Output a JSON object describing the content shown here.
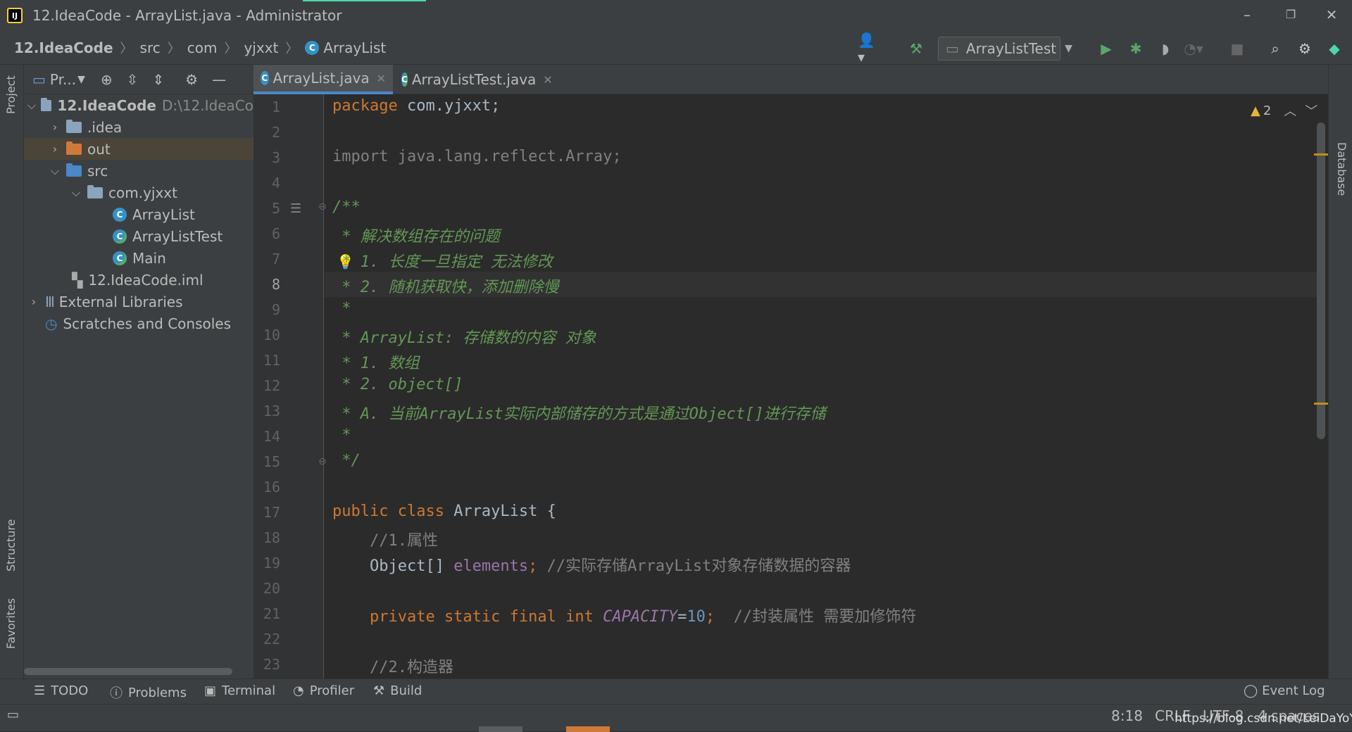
{
  "window": {
    "title": "12.IdeaCode - ArrayList.java - Administrator",
    "logo_text": "IJ"
  },
  "breadcrumb": [
    {
      "label": "12.IdeaCode"
    },
    {
      "label": "src"
    },
    {
      "label": "com"
    },
    {
      "label": "yjxxt"
    },
    {
      "label": "ArrayList"
    }
  ],
  "toolbar": {
    "run_config": "ArrayListTest"
  },
  "left_stripe": {
    "project": "Project",
    "structure": "Structure",
    "favorites": "Favorites"
  },
  "right_stripe": {
    "database": "Database"
  },
  "project_panel": {
    "title": "Pr...",
    "root": {
      "name": "12.IdeaCode",
      "path": "D:\\12.IdeaCo"
    },
    "items": [
      {
        "name": ".idea"
      },
      {
        "name": "out"
      },
      {
        "name": "src"
      },
      {
        "name": "com.yjxxt"
      },
      {
        "name": "ArrayList"
      },
      {
        "name": "ArrayListTest"
      },
      {
        "name": "Main"
      },
      {
        "name": "12.IdeaCode.iml"
      },
      {
        "name": "External Libraries"
      },
      {
        "name": "Scratches and Consoles"
      }
    ]
  },
  "tabs": [
    {
      "label": "ArrayList.java"
    },
    {
      "label": "ArrayListTest.java"
    }
  ],
  "editor": {
    "warnings": "2",
    "lines": [
      "1",
      "2",
      "3",
      "4",
      "5",
      "6",
      "7",
      "8",
      "9",
      "10",
      "11",
      "12",
      "13",
      "14",
      "15",
      "16",
      "17",
      "18",
      "19",
      "20",
      "21",
      "22",
      "23"
    ],
    "code": {
      "l1a": "package",
      "l1b": " com.yjxxt;",
      "l3a": "import",
      "l3b": " java.lang.reflect.Array;",
      "l5": "/**",
      "l6": " * 解决数组存在的问题",
      "l7": " * 1. 长度一旦指定 无法修改",
      "l8": " * 2. 随机获取快，添加删除慢",
      "l9": " *",
      "l10": " * ArrayList: 存储数的内容 对象",
      "l11": " * 1. 数组",
      "l12": " * 2. object[]",
      "l13": " * A. 当前ArrayList实际内部储存的方式是通过Object[]进行存储",
      "l14": " *",
      "l15": " */",
      "l17a": "public class",
      "l17b": " ArrayList {",
      "l18": "    //1.属性",
      "l19a": "    Object[] ",
      "l19b": "elements",
      "l19c": ";",
      "l19d": " //实际存储ArrayList对象存储数据的容器",
      "l21a": "    private static final int",
      "l21b": " CAPACITY",
      "l21c": "=",
      "l21d": "10",
      "l21e": ";",
      "l21f": "  //封装属性 需要加修饰符",
      "l23": "    //2.构造器"
    }
  },
  "bottom_tools": [
    {
      "label": "TODO"
    },
    {
      "label": "Problems"
    },
    {
      "label": "Terminal"
    },
    {
      "label": "Profiler"
    },
    {
      "label": "Build"
    }
  ],
  "event_log": "Event Log",
  "status": {
    "position": "8:18",
    "line_sep": "CRLF",
    "encoding": "UTF-8",
    "indent": "4 spaces"
  },
  "watermark": "https://blog.csdn.net/LeiDaYoYang"
}
